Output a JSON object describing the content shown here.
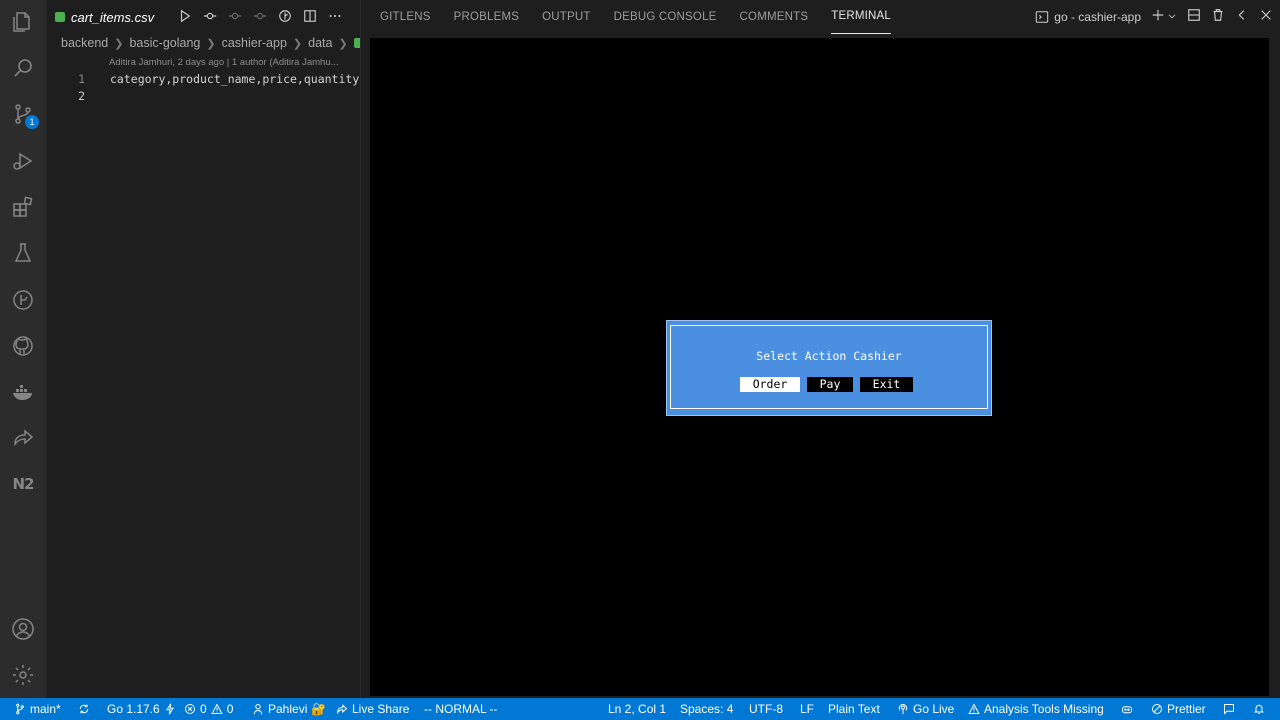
{
  "activity_bar": {
    "items": [
      "explorer-icon",
      "search-icon",
      "source-control-icon",
      "run-debug-icon",
      "extensions-icon",
      "testing-icon",
      "gitlens-icon",
      "github-icon",
      "docker-icon",
      "live-share-icon",
      "n2-icon"
    ],
    "source_control_badge": "1",
    "n2_label": "N2",
    "bottom": [
      "account-icon",
      "settings-icon"
    ]
  },
  "editor": {
    "tab_name": "cart_items.csv",
    "breadcrumb": [
      "backend",
      "basic-golang",
      "cashier-app",
      "data"
    ],
    "blame": "Aditira Jamhuri, 2 days ago | 1 author (Aditira Jamhu...",
    "lines": [
      {
        "num": "1",
        "text": "category,product_name,price,quantity"
      },
      {
        "num": "2",
        "text": ""
      }
    ]
  },
  "panel": {
    "tabs": [
      "GITLENS",
      "PROBLEMS",
      "OUTPUT",
      "DEBUG CONSOLE",
      "COMMENTS",
      "TERMINAL"
    ],
    "active_tab": "TERMINAL",
    "terminal_name": "go - cashier-app"
  },
  "dialog": {
    "title": "Select Action Cashier",
    "buttons": [
      "Order",
      "Pay",
      "Exit"
    ],
    "selected": "Order"
  },
  "status": {
    "branch": "main*",
    "go_version": "Go 1.17.6",
    "errors": "0",
    "warnings": "0",
    "user": "Pahlevi",
    "live_share": "Live Share",
    "vim_mode": "-- NORMAL --",
    "cursor": "Ln 2, Col 1",
    "spaces": "Spaces: 4",
    "encoding": "UTF-8",
    "eol": "LF",
    "language": "Plain Text",
    "go_live": "Go Live",
    "analysis": "Analysis Tools Missing",
    "prettier": "Prettier"
  },
  "colors": {
    "statusbar": "#0078d4",
    "dialog": "#4a8fe0",
    "terminal_bg": "#000000",
    "editor_bg": "#1e1e1e"
  }
}
